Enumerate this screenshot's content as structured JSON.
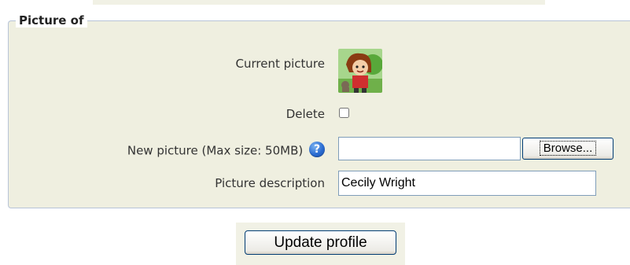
{
  "fieldset": {
    "legend": "Picture of"
  },
  "current_picture": {
    "label": "Current picture",
    "icon": "avatar-image"
  },
  "delete": {
    "label": "Delete",
    "checked": false
  },
  "new_picture": {
    "label": "New picture (Max size: 50MB)",
    "help_icon": "help-icon",
    "help_glyph": "?",
    "value": "",
    "browse_label": "Browse..."
  },
  "description": {
    "label": "Picture description",
    "value": "Cecily Wright"
  },
  "actions": {
    "update_label": "Update profile"
  },
  "colors": {
    "panel_background": "#efefe0",
    "panel_border": "#b8c4d8",
    "help_icon_blue": "#2a6bd1",
    "button_border": "#003c74"
  }
}
